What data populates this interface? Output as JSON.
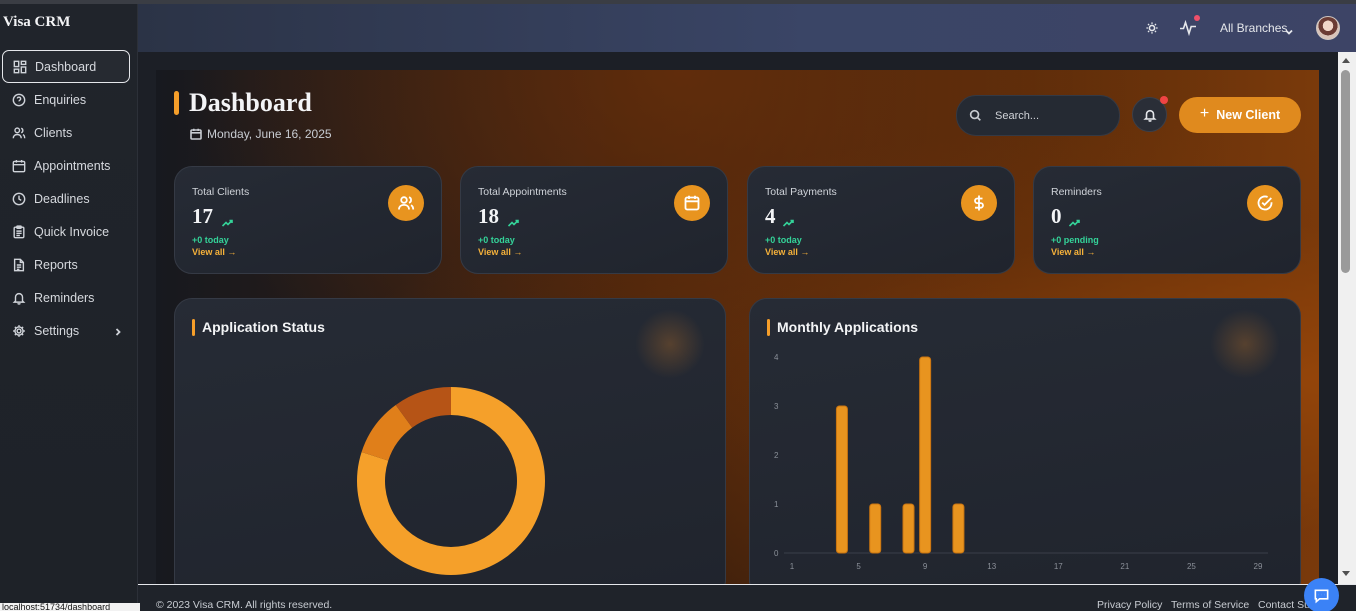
{
  "brand": "Visa CRM",
  "sidebar": {
    "items": [
      {
        "label": "Dashboard",
        "icon": "dashboard-icon",
        "active": true
      },
      {
        "label": "Enquiries",
        "icon": "help-circle-icon"
      },
      {
        "label": "Clients",
        "icon": "users-icon"
      },
      {
        "label": "Appointments",
        "icon": "calendar-icon"
      },
      {
        "label": "Deadlines",
        "icon": "clock-icon"
      },
      {
        "label": "Quick Invoice",
        "icon": "clipboard-icon"
      },
      {
        "label": "Reports",
        "icon": "file-text-icon"
      },
      {
        "label": "Reminders",
        "icon": "bell-icon"
      },
      {
        "label": "Settings",
        "icon": "gear-icon"
      }
    ]
  },
  "header": {
    "branch_label": "All Branches"
  },
  "page": {
    "title": "Dashboard",
    "date": "Monday, June 16, 2025",
    "search_placeholder": "Search...",
    "new_client_label": "New Client"
  },
  "stats": [
    {
      "label": "Total Clients",
      "value": "17",
      "sub": "+0 today",
      "link": "View all →",
      "icon": "users-icon"
    },
    {
      "label": "Total Appointments",
      "value": "18",
      "sub": "+0 today",
      "link": "View all →",
      "icon": "calendar-icon"
    },
    {
      "label": "Total Payments",
      "value": "4",
      "sub": "+0 today",
      "link": "View all →",
      "icon": "dollar-icon"
    },
    {
      "label": "Reminders",
      "value": "0",
      "sub": "+0 pending",
      "link": "View all →",
      "icon": "check-circle-icon"
    }
  ],
  "panels": {
    "status_title": "Application Status",
    "monthly_title": "Monthly Applications"
  },
  "chart_data": [
    {
      "type": "pie",
      "title": "Application Status",
      "slices": [
        {
          "value": 80,
          "color": "#f5a02a"
        },
        {
          "value": 10,
          "color": "#e07f1a"
        },
        {
          "value": 10,
          "color": "#b65416"
        }
      ]
    },
    {
      "type": "bar",
      "title": "Monthly Applications",
      "x_ticks": [
        "1",
        "5",
        "9",
        "13",
        "17",
        "21",
        "25",
        "29"
      ],
      "y_ticks": [
        "0",
        "1",
        "2",
        "3",
        "4"
      ],
      "ylim": [
        0,
        4
      ],
      "xlim": [
        1,
        29
      ],
      "bars": [
        {
          "x": 4,
          "value": 3
        },
        {
          "x": 6,
          "value": 1
        },
        {
          "x": 8,
          "value": 1
        },
        {
          "x": 9,
          "value": 4
        },
        {
          "x": 11,
          "value": 1
        }
      ],
      "color": "#e8941f"
    }
  ],
  "footer": {
    "copyright": "© 2023 Visa CRM. All rights reserved.",
    "links": [
      "Privacy Policy",
      "Terms of Service",
      "Contact Su"
    ]
  },
  "status_url": "localhost:51734/dashboard"
}
